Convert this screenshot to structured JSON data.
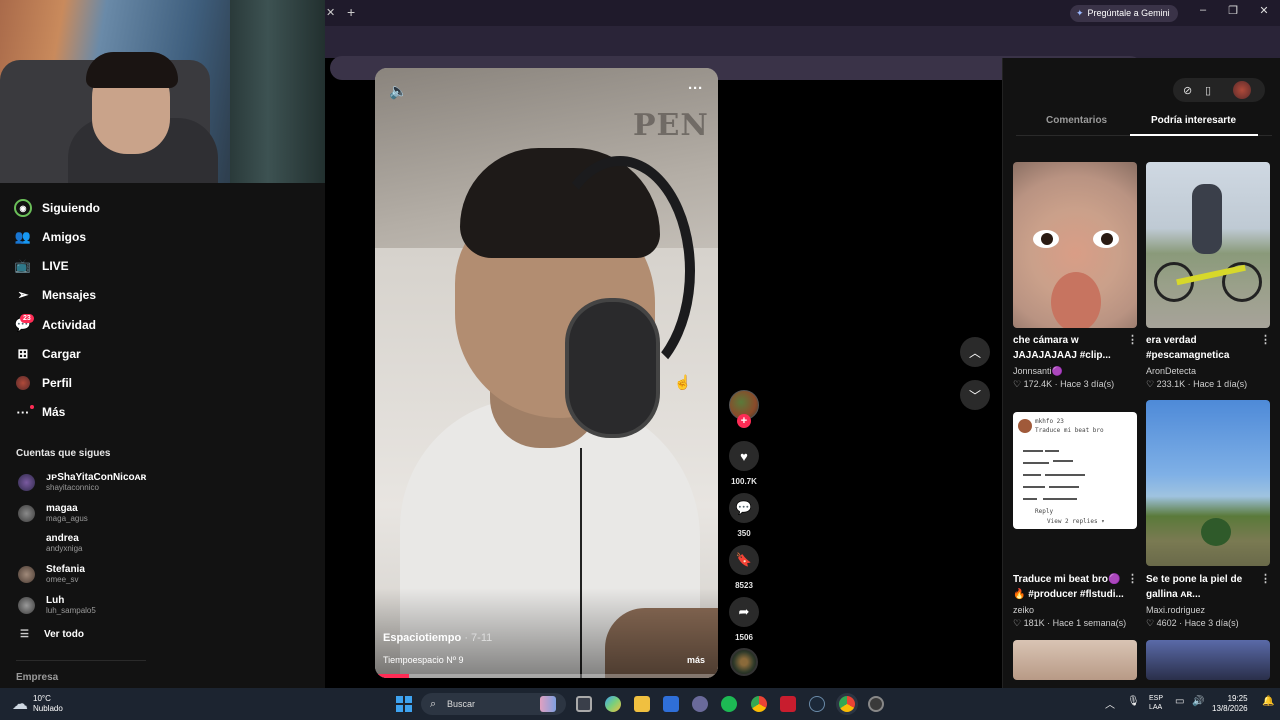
{
  "browser": {
    "gemini_label": "Pregúntale a Gemini",
    "profile_initial": "I"
  },
  "sidebar": {
    "items": [
      {
        "label": "Siguiendo",
        "icon": "following-icon"
      },
      {
        "label": "Amigos",
        "icon": "friends-icon"
      },
      {
        "label": "LIVE",
        "icon": "live-icon"
      },
      {
        "label": "Mensajes",
        "icon": "messages-icon"
      },
      {
        "label": "Actividad",
        "icon": "activity-icon"
      },
      {
        "label": "Cargar",
        "icon": "upload-icon"
      },
      {
        "label": "Perfil",
        "icon": "profile-icon"
      },
      {
        "label": "Más",
        "icon": "more-icon"
      }
    ],
    "activity_badge": "23",
    "following_title": "Cuentas que sigues",
    "accounts": [
      {
        "name": "ᴊᴘShaYitaConNicoᴀʀ",
        "user": "shayitaconnico"
      },
      {
        "name": "magaa",
        "user": "maga_agus"
      },
      {
        "name": "andrea",
        "user": "andyxniga"
      },
      {
        "name": "Stefania",
        "user": "omee_sv"
      },
      {
        "name": "Luh",
        "user": "luh_sampalo5"
      }
    ],
    "see_all": "Ver todo",
    "company": "Empresa"
  },
  "video": {
    "author": "Espaciotiempo",
    "date": "· 7-11",
    "description": "Tiempoespacio Nº 9",
    "more": "más",
    "sign_text": "PEN",
    "progress": 0.1
  },
  "actions": {
    "likes": "100.7K",
    "comments": "350",
    "saves": "8523",
    "shares": "1506"
  },
  "panel": {
    "tab_comments": "Comentarios",
    "tab_suggested": "Podría interesarte",
    "cards": [
      {
        "title": "che cámara w JAJAJAJAAJ #clip...",
        "author": "Jonnsanti🟣",
        "likes": "172.4K",
        "time": "Hace 3 día(s)"
      },
      {
        "title": "era verdad #pescamagnetica",
        "author": "AronDetecta",
        "likes": "233.1K",
        "time": "Hace 1 día(s)"
      },
      {
        "title": "Traduce mi beat bro🟣 🔥 #producer #flstudi...",
        "author": "zeiko",
        "likes": "181K",
        "time": "Hace 1 semana(s)"
      },
      {
        "title": "Se te pone la piel de gallina ᴀʀ...",
        "author": "Maxi.rodriguez",
        "likes": "4602",
        "time": "Hace 3 día(s)"
      }
    ],
    "note_header": "mkhfo 23",
    "note_subtitle": "Traduce mi beat bro",
    "note_reply": "Reply",
    "note_replies": "View 2 replies ▾"
  },
  "taskbar": {
    "temp": "10°C",
    "weather": "Nublado",
    "search_placeholder": "Buscar",
    "lang1": "ESP",
    "lang2": "LAA",
    "time": "19:25",
    "date": "13/8/2026"
  }
}
